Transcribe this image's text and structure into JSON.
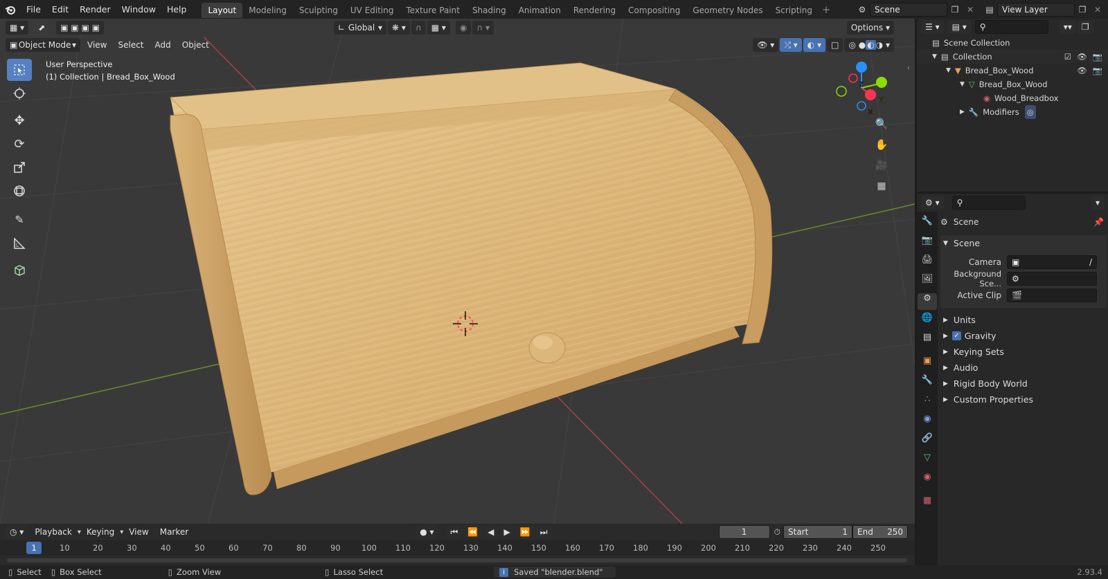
{
  "topbar": {
    "menus": [
      "File",
      "Edit",
      "Render",
      "Window",
      "Help"
    ],
    "workspaces": [
      "Layout",
      "Modeling",
      "Sculpting",
      "UV Editing",
      "Texture Paint",
      "Shading",
      "Animation",
      "Rendering",
      "Compositing",
      "Geometry Nodes",
      "Scripting"
    ],
    "active_workspace": "Layout",
    "scene_name": "Scene",
    "view_layer": "View Layer"
  },
  "viewport": {
    "transform_orientation": "Global",
    "options_label": "Options",
    "mode": "Object Mode",
    "menus": [
      "View",
      "Select",
      "Add",
      "Object"
    ],
    "overlay_line1": "User Perspective",
    "overlay_line2": "(1) Collection | Bread_Box_Wood",
    "gizmo_axes": [
      "Z",
      "Y",
      "X"
    ]
  },
  "outliner": {
    "rows": [
      {
        "label": "Scene Collection",
        "indent": 0
      },
      {
        "label": "Collection",
        "indent": 1
      },
      {
        "label": "Bread_Box_Wood",
        "indent": 2
      },
      {
        "label": "Bread_Box_Wood",
        "indent": 3
      },
      {
        "label": "Wood_Breadbox",
        "indent": 4
      },
      {
        "label": "Modifiers",
        "indent": 3
      }
    ]
  },
  "properties": {
    "context_title": "Scene",
    "section_title": "Scene",
    "fields": [
      {
        "label": "Camera",
        "value": ""
      },
      {
        "label": "Background Sce...",
        "value": ""
      },
      {
        "label": "Active Clip",
        "value": ""
      }
    ],
    "panels": [
      "Units",
      "Gravity",
      "Keying Sets",
      "Audio",
      "Rigid Body World",
      "Custom Properties"
    ],
    "gravity_checked": true
  },
  "timeline": {
    "menus": [
      "Playback",
      "Keying",
      "View",
      "Marker"
    ],
    "current_frame": "1",
    "start_label": "Start",
    "start": "1",
    "end_label": "End",
    "end": "250",
    "ticks": [
      "1",
      "10",
      "20",
      "30",
      "40",
      "50",
      "60",
      "70",
      "80",
      "90",
      "100",
      "110",
      "120",
      "130",
      "140",
      "150",
      "160",
      "170",
      "180",
      "190",
      "200",
      "210",
      "220",
      "230",
      "240",
      "250"
    ]
  },
  "statusbar": {
    "select": "Select",
    "box_select": "Box Select",
    "zoom_view": "Zoom View",
    "lasso_select": "Lasso Select",
    "message": "Saved \"blender.blend\"",
    "version": "2.93.4"
  },
  "colors": {
    "accent": "#5680c2",
    "wood_light": "#e6c48a",
    "wood_dark": "#c9a066",
    "axis_x": "#ff3352",
    "axis_y": "#8bdc00",
    "axis_z": "#2890ff"
  }
}
